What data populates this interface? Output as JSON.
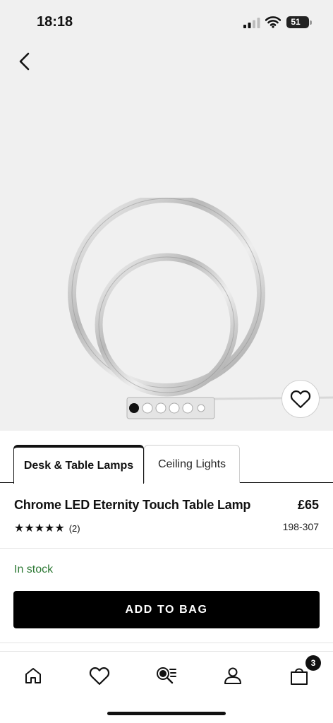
{
  "status_bar": {
    "time": "18:18",
    "battery": "51"
  },
  "hero": {
    "image_alt": "Chrome LED Eternity Touch Table Lamp"
  },
  "tabs": [
    {
      "label": "Desk & Table Lamps",
      "active": true
    },
    {
      "label": "Ceiling Lights",
      "active": false
    }
  ],
  "product": {
    "title": "Chrome LED Eternity Touch Table Lamp",
    "price": "£65",
    "stars": "★★★★★",
    "rating_value": 5,
    "review_count": "(2)",
    "code": "198-307",
    "stock_status": "In stock",
    "stock_color": "#2f7a36"
  },
  "actions": {
    "add_to_bag": "ADD TO BAG"
  },
  "bottom_nav": {
    "items": [
      {
        "icon": "home-icon"
      },
      {
        "icon": "heart-icon"
      },
      {
        "icon": "search-list-icon"
      },
      {
        "icon": "account-icon"
      },
      {
        "icon": "bag-icon"
      }
    ],
    "bag_count": "3"
  }
}
